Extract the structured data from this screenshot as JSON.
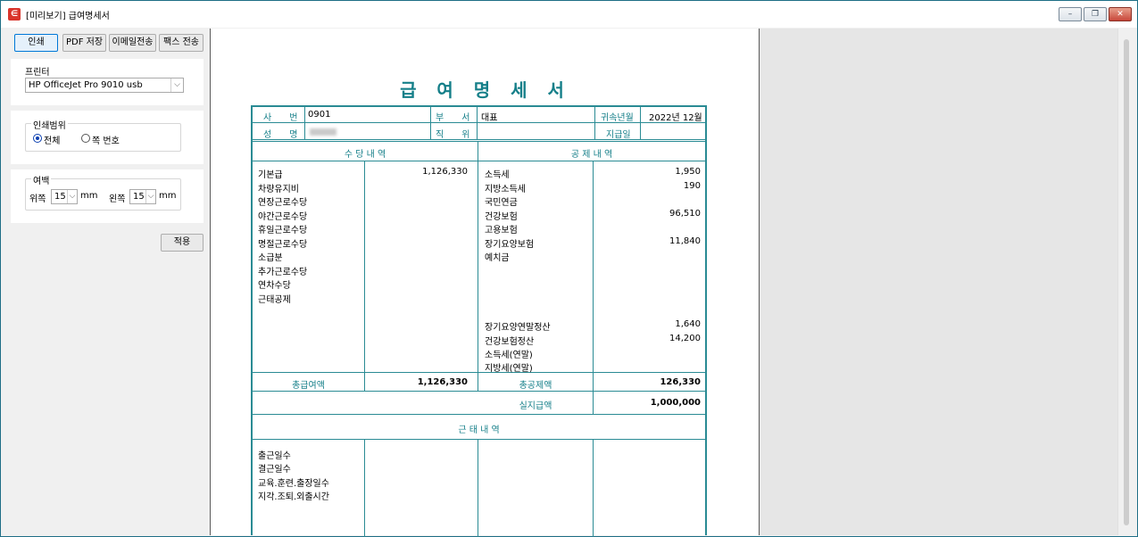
{
  "window": {
    "title": "[미리보기] 급여명세서",
    "app_icon": "app-icon"
  },
  "toolbar": {
    "print_label": "인쇄",
    "pdf_label": "PDF 저장",
    "email_label": "이메일전송",
    "fax_label": "팩스 전송"
  },
  "printer": {
    "label": "프린터",
    "selected": "HP OfficeJet Pro 9010 usb"
  },
  "print_range": {
    "label": "인쇄범위",
    "option_all": "전체",
    "option_pages": "쪽 번호",
    "selected": "전체"
  },
  "margin": {
    "label": "여백",
    "top_label": "위쪽",
    "top_value": "15",
    "left_label": "왼쪽",
    "left_value": "15",
    "unit": "mm"
  },
  "apply_label": "적용",
  "payslip": {
    "title": "급 여 명 세 서",
    "header": {
      "emp_no_label": "사　　번",
      "emp_no": "0901",
      "dept_label": "부　　서",
      "dept": "대표",
      "period_label": "귀속년월",
      "period": "2022년 12월",
      "name_label": "성　　명",
      "position_label": "직　　위",
      "paydate_label": "지급일"
    },
    "allowance_title": "수 당 내 역",
    "deduction_title": "공 제 내 역",
    "allowances": [
      {
        "name": "기본급",
        "amount": "1,126,330"
      },
      {
        "name": "차량유지비",
        "amount": ""
      },
      {
        "name": "연장근로수당",
        "amount": ""
      },
      {
        "name": "야간근로수당",
        "amount": ""
      },
      {
        "name": "휴일근로수당",
        "amount": ""
      },
      {
        "name": "명절근로수당",
        "amount": ""
      },
      {
        "name": "소급분",
        "amount": ""
      },
      {
        "name": "추가근로수당",
        "amount": ""
      },
      {
        "name": "연차수당",
        "amount": ""
      },
      {
        "name": "근태공제",
        "amount": ""
      }
    ],
    "deductions": [
      {
        "name": "소득세",
        "amount": "1,950"
      },
      {
        "name": "지방소득세",
        "amount": "190"
      },
      {
        "name": "국민연금",
        "amount": ""
      },
      {
        "name": "건강보험",
        "amount": "96,510"
      },
      {
        "name": "고용보험",
        "amount": ""
      },
      {
        "name": "장기요양보험",
        "amount": "11,840"
      },
      {
        "name": "예치금",
        "amount": ""
      }
    ],
    "deductions_extra": [
      {
        "name": "장기요양연말정산",
        "amount": "1,640"
      },
      {
        "name": "건강보험정산",
        "amount": "14,200"
      },
      {
        "name": "소득세(연말)",
        "amount": ""
      },
      {
        "name": "지방세(연말)",
        "amount": ""
      }
    ],
    "total_pay_label": "총급여액",
    "total_pay": "1,126,330",
    "total_deduction_label": "총공제액",
    "total_deduction": "126,330",
    "net_pay_label": "실지급액",
    "net_pay": "1,000,000",
    "attendance_title": "근 태 내 역",
    "attendance": [
      "출근일수",
      "결근일수",
      "교육.훈련.출장일수",
      "지각.조퇴.외출시간"
    ]
  }
}
